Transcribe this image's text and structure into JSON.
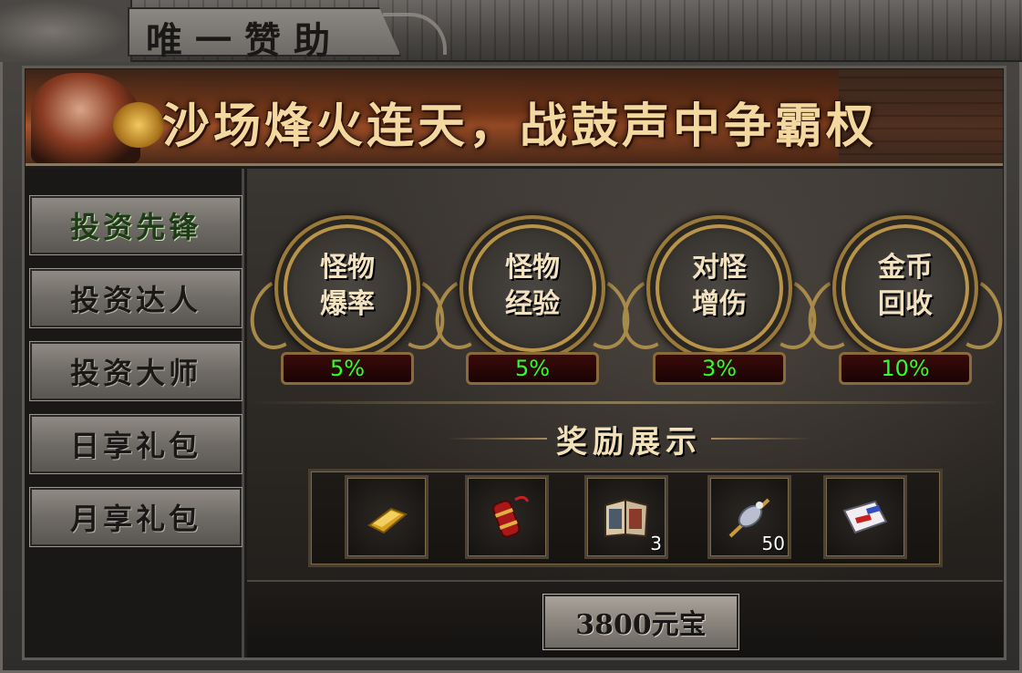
{
  "window": {
    "title": "唯一赞助"
  },
  "banner": {
    "slogan": "沙场烽火连天，战鼓声中争霸权"
  },
  "sidebar": {
    "items": [
      {
        "label": "投资先锋",
        "active": true
      },
      {
        "label": "投资达人",
        "active": false
      },
      {
        "label": "投资大师",
        "active": false
      },
      {
        "label": "日享礼包",
        "active": false
      },
      {
        "label": "月享礼包",
        "active": false
      }
    ]
  },
  "bonuses": [
    {
      "line1": "怪物",
      "line2": "爆率",
      "value": "5%"
    },
    {
      "line1": "怪物",
      "line2": "经验",
      "value": "5%"
    },
    {
      "line1": "对怪",
      "line2": "增伤",
      "value": "3%"
    },
    {
      "line1": "金币",
      "line2": "回收",
      "value": "10%"
    }
  ],
  "rewards": {
    "title": "奖励展示",
    "items": [
      {
        "icon": "gold-bar-icon",
        "count": ""
      },
      {
        "icon": "firecracker-icon",
        "count": ""
      },
      {
        "icon": "book-icon",
        "count": "3"
      },
      {
        "icon": "skewer-icon",
        "count": "50"
      },
      {
        "icon": "scroll-card-icon",
        "count": ""
      }
    ]
  },
  "purchase": {
    "label": "3800元宝"
  },
  "colors": {
    "percent_green": "#2cff2c",
    "gold_trim": "#a88a4a"
  }
}
